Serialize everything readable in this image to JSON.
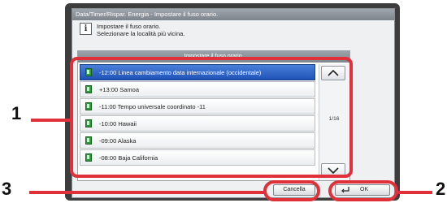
{
  "window": {
    "title": "Data/Timer/Rispar. Energia - Impostare il fuso orario."
  },
  "message": {
    "line1": "Impostare il fuso orario.",
    "line2": "Selezionare la località più vicina."
  },
  "list": {
    "header": "Impostare il fuso orario.",
    "items": [
      {
        "label": "-12:00 Linea cambiamento data internazionale (occidentale)",
        "selected": true
      },
      {
        "label": "+13:00 Samoa",
        "selected": false
      },
      {
        "label": "-11:00 Tempo universale coordinato -11",
        "selected": false
      },
      {
        "label": "-10:00 Hawaii",
        "selected": false
      },
      {
        "label": "-09:00 Alaska",
        "selected": false
      },
      {
        "label": "-08:00 Baja California",
        "selected": false
      }
    ],
    "page_indicator": "1/16"
  },
  "buttons": {
    "cancel": "Cancella",
    "ok": "OK"
  },
  "callouts": {
    "list": "1",
    "ok": "2",
    "cancel": "3"
  },
  "colors": {
    "callout": "#e0303a",
    "selected_row": "#2b5fc4",
    "flag": "#2e9a3c"
  }
}
